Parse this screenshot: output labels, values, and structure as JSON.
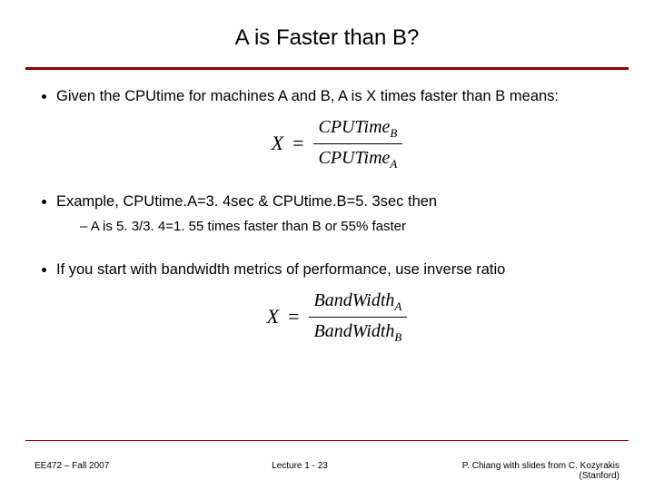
{
  "title": "A is Faster than B?",
  "bullets": {
    "b1": "Given the CPUtime for machines A and B, A is X times faster than B means:",
    "b2": "Example, CPUtime.A=3. 4sec & CPUtime.B=5. 3sec then",
    "b2_sub": "A is 5. 3/3. 4=1. 55 times faster than B or 55% faster",
    "b3": "If you start with bandwidth metrics of performance, use inverse ratio"
  },
  "formula1": {
    "lhs": "X",
    "eq": "=",
    "num": "CPUTime",
    "num_sub": "B",
    "den": "CPUTime",
    "den_sub": "A"
  },
  "formula2": {
    "lhs": "X",
    "eq": "=",
    "num": "BandWidth",
    "num_sub": "A",
    "den": "BandWidth",
    "den_sub": "B"
  },
  "footer": {
    "left": "EE472 – Fall 2007",
    "center": "Lecture 1 - 23",
    "right": "P. Chiang with slides from C. Kozyrakis (Stanford)"
  }
}
